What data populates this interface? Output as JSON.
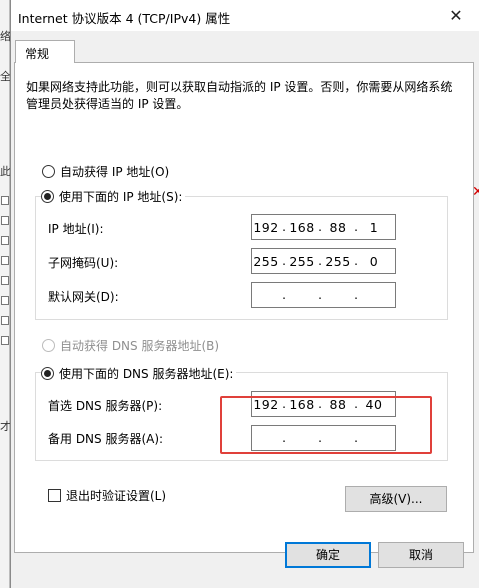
{
  "window": {
    "title": "Internet 协议版本 4 (TCP/IPv4) 属性",
    "close_glyph": "✕"
  },
  "tabs": [
    {
      "label": "常规"
    }
  ],
  "description": "如果网络支持此功能，则可以获取自动指派的 IP 设置。否则，你需要从网络系统管理员处获得适当的 IP 设置。",
  "ip_section": {
    "auto_label": "自动获得 IP 地址(O)",
    "manual_label": "使用下面的 IP 地址(S):",
    "ip_label": "IP 地址(I):",
    "ip_value": [
      "192",
      "168",
      "88",
      "1"
    ],
    "mask_label": "子网掩码(U):",
    "mask_value": [
      "255",
      "255",
      "255",
      "0"
    ],
    "gateway_label": "默认网关(D):",
    "gateway_value": [
      "",
      "",
      "",
      ""
    ]
  },
  "dns_section": {
    "auto_label": "自动获得 DNS 服务器地址(B)",
    "manual_label": "使用下面的 DNS 服务器地址(E):",
    "preferred_label": "首选 DNS 服务器(P):",
    "preferred_value": [
      "192",
      "168",
      "88",
      "40"
    ],
    "alternate_label": "备用 DNS 服务器(A):",
    "alternate_value": [
      "",
      "",
      "",
      ""
    ]
  },
  "validate_label": "退出时验证设置(L)",
  "advanced_label": "高级(V)...",
  "ok_label": "确定",
  "cancel_label": "取消",
  "background_fragments": {
    "top_char": "络",
    "mid_char": "全",
    "left_char": "此",
    "lower_char": "才",
    "red_mark": "✕"
  },
  "colors": {
    "highlight_box": "#e0403a",
    "primary_button_border": "#0078d7"
  }
}
